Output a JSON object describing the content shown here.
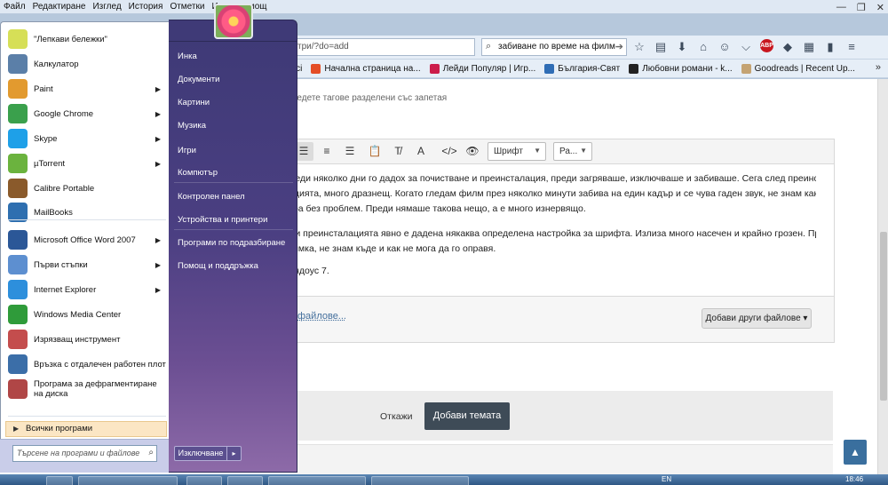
{
  "browser": {
    "menu": [
      {
        "label": "Файл",
        "u": "Ф"
      },
      {
        "label": "Редактиране",
        "u": "Р"
      },
      {
        "label": "Изглед",
        "u": "И"
      },
      {
        "label": "История",
        "u": "с"
      },
      {
        "label": "Отметки",
        "u": "О"
      },
      {
        "label": "Инстр",
        "u": ""
      },
      {
        "label": "омощ",
        "u": ""
      }
    ],
    "url": "три/?do=add",
    "search_value": "забиване по време на филм",
    "bookmarks": [
      {
        "label": "Начална страница на...",
        "color": "#e44d26"
      },
      {
        "label": "Лейди Популяр | Игр...",
        "color": "#cc1d4a"
      },
      {
        "label": "България-Свят",
        "color": "#2f6db5"
      },
      {
        "label": "Любовни романи - k...",
        "color": "#222222"
      },
      {
        "label": "Goodreads | Recent Up...",
        "color": "#c4a373"
      }
    ],
    "bookmarks_prefix": "orici"
  },
  "page": {
    "tags_hint": "въведете тагове разделени със запетая",
    "editor": {
      "font_select": "Шрифт",
      "size_select": "Ра...",
      "lines": [
        "Преди няколко дни го дадох за почистване и преинсталация, преди загряваше, изключваше и забиваше. Сега след преинста-",
        "лацията, много дразнещ. Когато гледам филм през няколко минути забива на един кадър и се чува гаден звук, не знам как да го",
        "спра без проблем. Преди нямаше такова нещо, а е много изнервящо.",
        "При преинсталацията явно е дадена някаква определена настройка за шрифта. Излиза много насечен и крайно грозен. Прилагам",
        "снимка, не знам къде и как не мога да го оправя.",
        "Уиндоус 7."
      ]
    },
    "attach_link": "файлове...",
    "more_files_button": "Добави други файлове ▾",
    "cancel_label": "Откажи",
    "submit_label": "Добави темата",
    "back_to_top": "▲"
  },
  "start_menu": {
    "pinned": [
      {
        "label": "\"Лепкави бележки\"",
        "icon": "sticky-notes-icon",
        "color": "#d6df57",
        "arrow": false
      },
      {
        "label": "Калкулатор",
        "icon": "calculator-icon",
        "color": "#5b7fa8",
        "arrow": false
      },
      {
        "label": "Paint",
        "icon": "paint-icon",
        "color": "#e29a2f",
        "arrow": true
      },
      {
        "label": "Google Chrome",
        "icon": "chrome-icon",
        "color": "#3aa04c",
        "arrow": true
      },
      {
        "label": "Skype",
        "icon": "skype-icon",
        "color": "#1ea0e8",
        "arrow": true
      },
      {
        "label": "µTorrent",
        "icon": "utorrent-icon",
        "color": "#6bb33e",
        "arrow": true
      },
      {
        "label": "Calibre Portable",
        "icon": "calibre-icon",
        "color": "#8a5a2b",
        "arrow": false
      },
      {
        "label": "MailBooks",
        "icon": "mailbooks-icon",
        "color": "#2e6fb0",
        "arrow": false
      },
      {
        "label": "Microsoft Office Word 2007",
        "icon": "word-icon",
        "color": "#2b5797",
        "arrow": true
      },
      {
        "label": "Първи стъпки",
        "icon": "getting-started-icon",
        "color": "#5d8fd0",
        "arrow": true
      },
      {
        "label": "Internet Explorer",
        "icon": "ie-icon",
        "color": "#2d8fdc",
        "arrow": true
      },
      {
        "label": "Windows Media Center",
        "icon": "media-center-icon",
        "color": "#2f9b3a",
        "arrow": false
      },
      {
        "label": "Изрязващ инструмент",
        "icon": "scissors-icon",
        "color": "#c44d4d",
        "arrow": false
      },
      {
        "label": "Връзка с отдалечен работен плот",
        "icon": "remote-desktop-icon",
        "color": "#3b6ea8",
        "arrow": false
      },
      {
        "label": "Програма за дефрагментиране на диска",
        "icon": "defrag-icon",
        "color": "#b04646",
        "arrow": false
      }
    ],
    "all_programs": "Всички програми",
    "search_placeholder": "Търсене на програми и файлове",
    "right_links": [
      "Инка",
      "Документи",
      "Картини",
      "Музика",
      "Игри",
      "Компютър",
      "Контролен панел",
      "Устройства и принтери",
      "Програми по подразбиране",
      "Помощ и поддръжка"
    ],
    "shutdown": "Изключване"
  },
  "taskbar": {
    "tray_lang": "EN",
    "clock": "18:46"
  }
}
